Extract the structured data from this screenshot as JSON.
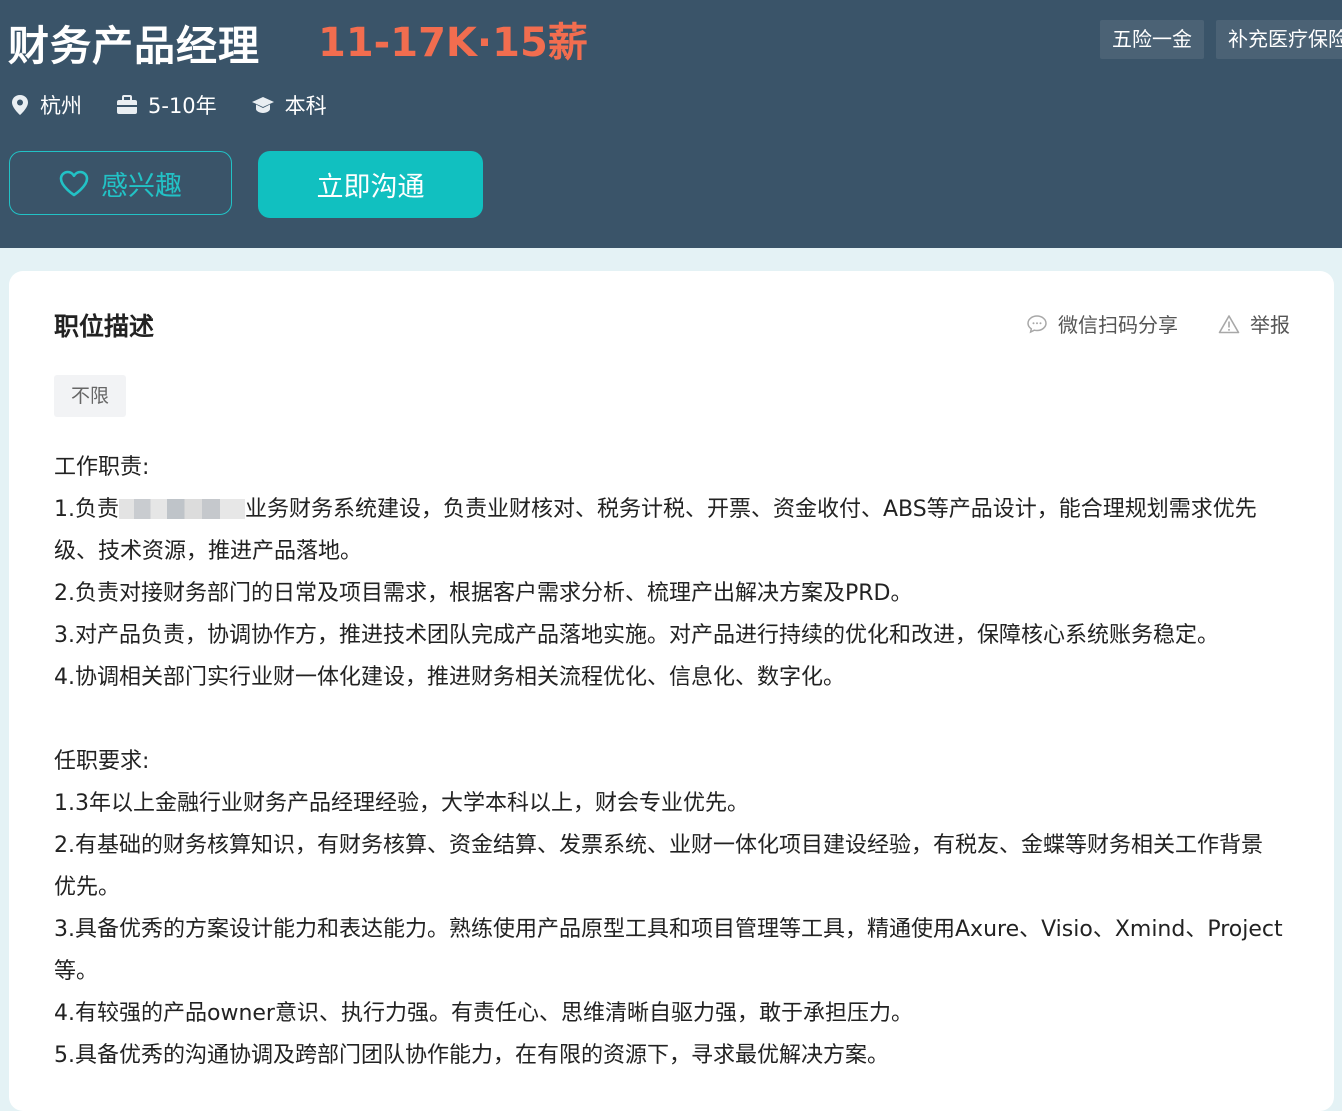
{
  "header": {
    "title": "财务产品经理",
    "salary": "11-17K·15薪",
    "tags": [
      "五险一金",
      "补充医疗保险"
    ],
    "meta": {
      "city": "杭州",
      "experience": "5-10年",
      "degree": "本科"
    },
    "interest_label": "感兴趣",
    "chat_label": "立即沟通"
  },
  "card": {
    "section_title": "职位描述",
    "share_label": "微信扫码分享",
    "report_label": "举报",
    "chip": "不限",
    "desc": {
      "heading1": "工作职责:",
      "r1_pre": "1.负责",
      "r1_post": "业务财务系统建设，负责业财核对、税务计税、开票、资金收付、ABS等产品设计，能合理规划需求优先",
      "r1_cont": "级、技术资源，推进产品落地。",
      "r2": "2.负责对接财务部门的日常及项目需求，根据客户需求分析、梳理产出解决方案及PRD。",
      "r3": "3.对产品负责，协调协作方，推进技术团队完成产品落地实施。对产品进行持续的优化和改进，保障核心系统账务稳定。",
      "r4": "4.协调相关部门实行业财一体化建设，推进财务相关流程优化、信息化、数字化。",
      "heading2": "任职要求:",
      "q1": "1.3年以上金融行业财务产品经理经验，大学本科以上，财会专业优先。",
      "q2": "2.有基础的财务核算知识，有财务核算、资金结算、发票系统、业财一体化项目建设经验，有税友、金蝶等财务相关工作背景",
      "q2_cont": "优先。",
      "q3": "3.具备优秀的方案设计能力和表达能力。熟练使用产品原型工具和项目管理等工具，精通使用Axure、Visio、Xmind、Project",
      "q3_cont": "等。",
      "q4": "4.有较强的产品owner意识、执行力强。有责任心、思维清晰自驱力强，敢于承担压力。",
      "q5": "5.具备优秀的沟通协调及跨部门团队协作能力，在有限的资源下，寻求最优解决方案。"
    }
  },
  "colors": {
    "header_bg": "#3a5469",
    "salary": "#f26d4f",
    "accent": "#11c0c0",
    "page_bg": "#e4f2f5"
  },
  "icons": [
    "location-pin-icon",
    "briefcase-icon",
    "graduation-cap-icon",
    "heart-icon",
    "chat-bubble-icon",
    "warning-triangle-icon"
  ]
}
